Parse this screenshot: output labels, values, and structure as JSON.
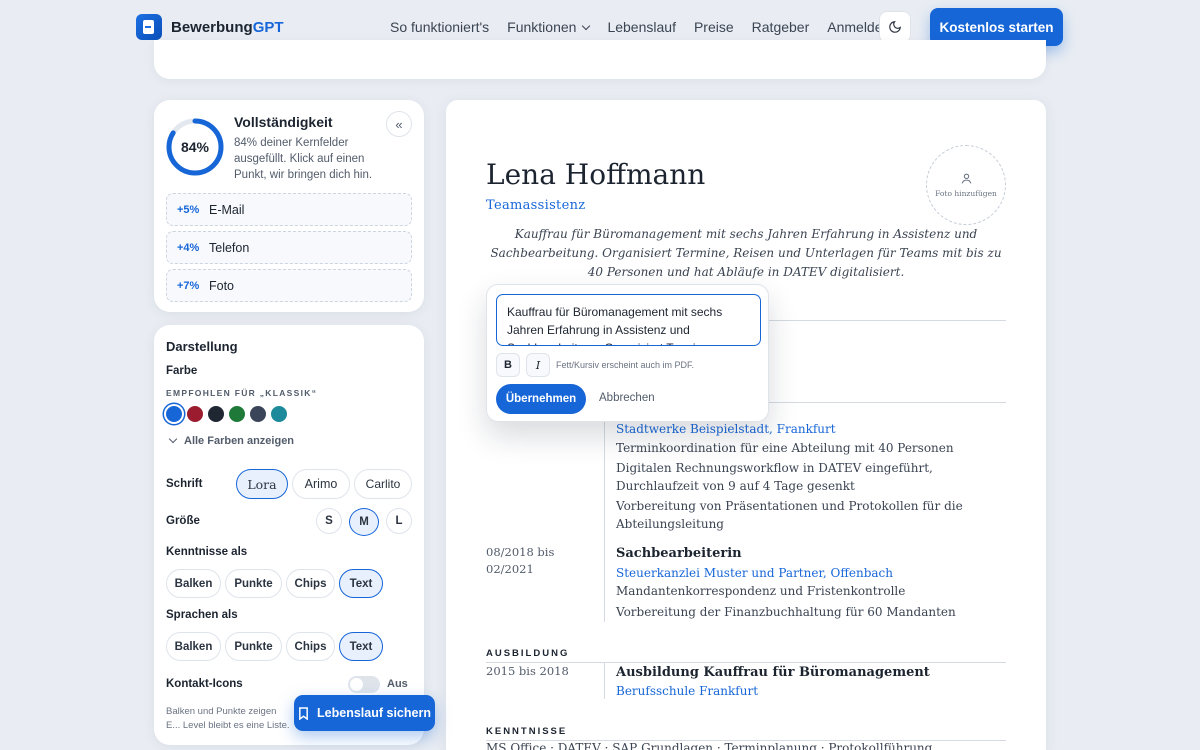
{
  "brand": {
    "name_part1": "Bewerbung",
    "name_part2": "GPT"
  },
  "nav": {
    "links": [
      "So funktioniert's",
      "Funktionen",
      "Lebenslauf",
      "Preise",
      "Ratgeber",
      "Anmelden"
    ],
    "cta_label": "Kostenlos starten"
  },
  "completeness": {
    "title": "Vollständigkeit",
    "percent": 84,
    "percent_label": "84%",
    "description": "84% deiner Kernfelder ausgefüllt. Klick auf einen Punkt, wir bringen dich hin.",
    "missing": [
      {
        "pct": "+5%",
        "label": "E-Mail"
      },
      {
        "pct": "+4%",
        "label": "Telefon"
      },
      {
        "pct": "+7%",
        "label": "Foto"
      }
    ]
  },
  "display": {
    "title": "Darstellung",
    "color_label": "Farbe",
    "recommended_label": "EMPFOHLEN FÜR „KLASSIK“",
    "colors": [
      "#1766d8",
      "#9b1c2e",
      "#1f2733",
      "#1f7a3a",
      "#3b4559",
      "#1c8a9b"
    ],
    "show_all_colors": "Alle Farben anzeigen",
    "font_label": "Schrift",
    "fonts": [
      "Lora",
      "Arimo",
      "Carlito"
    ],
    "size_label": "Größe",
    "sizes": [
      "S",
      "M",
      "L"
    ],
    "skills_label": "Kenntnisse als",
    "skills_options": [
      "Balken",
      "Punkte",
      "Chips",
      "Text"
    ],
    "languages_label": "Sprachen als",
    "languages_options": [
      "Balken",
      "Punkte",
      "Chips",
      "Text"
    ],
    "contact_icons_label": "Kontakt-Icons",
    "contact_icons_state": "Aus",
    "hint": "Balken und Punkte zeigen E... Level bleibt es eine Liste."
  },
  "save_button": "Lebenslauf sichern",
  "resume": {
    "name": "Lena Hoffmann",
    "role": "Teamassistenz",
    "photo_label": "Foto hinzufügen",
    "summary": "Kauffrau für Büromanagement mit sechs Jahren Erfahrung in Assistenz und Sachbearbeitung. Organisiert Termine, Reisen und Unterlagen für Teams mit bis zu 40 Personen und hat Abläufe in DATEV digitalisiert.",
    "job1": {
      "company": "Stadtwerke Beispielstadt, Frankfurt",
      "bullets": [
        "Terminkoordination für eine Abteilung mit 40 Personen",
        "Digitalen Rechnungsworkflow in DATEV eingeführt, Durchlaufzeit von 9 auf 4 Tage gesenkt",
        "Vorbereitung von Präsentationen und Protokollen für die Abteilungsleitung"
      ]
    },
    "job2": {
      "date": "08/2018 bis 02/2021",
      "title": "Sachbearbeiterin",
      "company": "Steuerkanzlei Muster und Partner, Offenbach",
      "bullets": [
        "Mandantenkorrespondenz und Fristenkontrolle",
        "Vorbereitung der Finanzbuchhaltung für 60 Mandanten"
      ]
    },
    "education_heading": "AUSBILDUNG",
    "education": {
      "date": "2015 bis 2018",
      "title": "Ausbildung Kauffrau für Büromanagement",
      "school": "Berufsschule Frankfurt"
    },
    "skills_heading": "KENNTNISSE",
    "skills_text": "MS Office · DATEV · SAP Grundlagen · Terminplanung · Protokollführung"
  },
  "editor": {
    "text": "Kauffrau für Büromanagement mit sechs Jahren Erfahrung in Assistenz und Sachbearbeitung. Organisiert Termine, Reisen",
    "bold_label": "B",
    "italic_label": "I",
    "format_hint": "Fett/Kursiv erscheint auch im PDF.",
    "apply_label": "Übernehmen",
    "cancel_label": "Abbrechen"
  }
}
